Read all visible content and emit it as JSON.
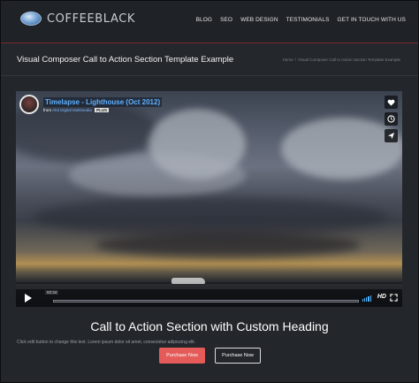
{
  "header": {
    "logo_text": "COFFEEBLACK",
    "nav": [
      "BLOG",
      "SEO",
      "WEB DESIGN",
      "TESTIMONIALS",
      "GET IN TOUCH WITH US"
    ]
  },
  "titlebar": {
    "title": "Visual Composer Call to Action Section Template Example",
    "breadcrumb": [
      "Home",
      "Visual Composer Call to Action Section Template Example"
    ]
  },
  "video": {
    "title": "Timelapse - Lighthouse (Oct 2012)",
    "from_label": "from",
    "author": "Ahd Digital Multimedia",
    "plus_badge": "PLUS",
    "timecode": "02:34",
    "hd_label": "HD",
    "progress": 0.0,
    "side_icons": [
      "heart-icon",
      "clock-icon",
      "send-icon"
    ]
  },
  "cta": {
    "heading": "Call to Action Section with Custom Heading",
    "text": "Click edit button to change this text. Lorem ipsum dolor sit amet, consectetur adipiscing elit.",
    "primary_button": "Purchase Now",
    "secondary_button": "Purchase Now",
    "primary_color": "#e55b59"
  }
}
